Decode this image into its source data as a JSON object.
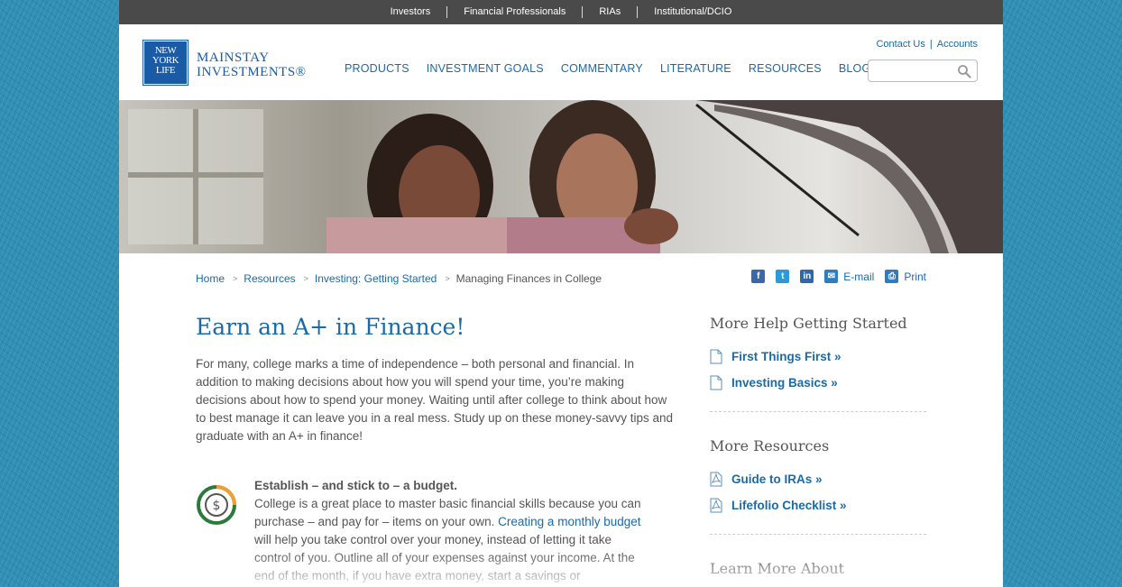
{
  "utility_nav": {
    "items": [
      "Investors",
      "Financial Professionals",
      "RIAs",
      "Institutional/DCIO"
    ]
  },
  "logo": {
    "mark_lines": [
      "NEW",
      "YORK",
      "LIFE"
    ],
    "brand_line1": "MAINSTAY",
    "brand_line2": "INVESTMENTS®"
  },
  "top_links": {
    "contact": "Contact Us",
    "separator": "|",
    "accounts": "Accounts"
  },
  "search": {
    "placeholder": "",
    "icon": "search-icon"
  },
  "main_nav": {
    "items": [
      "PRODUCTS",
      "INVESTMENT GOALS",
      "COMMENTARY",
      "LITERATURE",
      "RESOURCES",
      "BLOG"
    ]
  },
  "breadcrumb": {
    "items": [
      "Home",
      "Resources",
      "Investing: Getting Started"
    ],
    "current": "Managing Finances in College",
    "separator": ">"
  },
  "share": {
    "facebook": "f",
    "twitter": "t",
    "linkedin": "in",
    "email_label": "E-mail",
    "print_label": "Print"
  },
  "article": {
    "headline": "Earn an A+ in Finance!",
    "intro": "For many, college marks a time of independence – both personal and financial. In addition to making decisions about how you will spend your time, you’re making decisions about how to spend your money. Waiting until after college to think about how to best manage it can leave you in a real mess. Study up on these money-savvy tips and graduate with an A+ in finance!",
    "tip1": {
      "title": "Establish – and stick to – a budget.",
      "body_part1": "College is a great place to master basic financial skills because you can purchase – and pay for – items on your own. ",
      "link": "Creating a monthly budget",
      "body_part2": " will help you take control over your money, instead of letting it take control of you. Outline all of your expenses against your income. At the end of the month, if you have extra money, start a savings or"
    }
  },
  "sidebar": {
    "section1": {
      "heading": "More Help Getting Started",
      "links": [
        "First Things First »",
        "Investing Basics »"
      ]
    },
    "section2": {
      "heading": "More Resources",
      "links": [
        "Guide to IRAs »",
        "Lifefolio Checklist »"
      ]
    },
    "section3": {
      "heading": "Learn More About"
    }
  },
  "colors": {
    "brand_blue": "#1a5ba8",
    "link_blue": "#1a6aa8",
    "utility_bar": "#4a4a4a",
    "background_texture": "#2f8fb5",
    "budget_icon_green": "#2a7a3a",
    "budget_icon_orange": "#f0a030"
  }
}
